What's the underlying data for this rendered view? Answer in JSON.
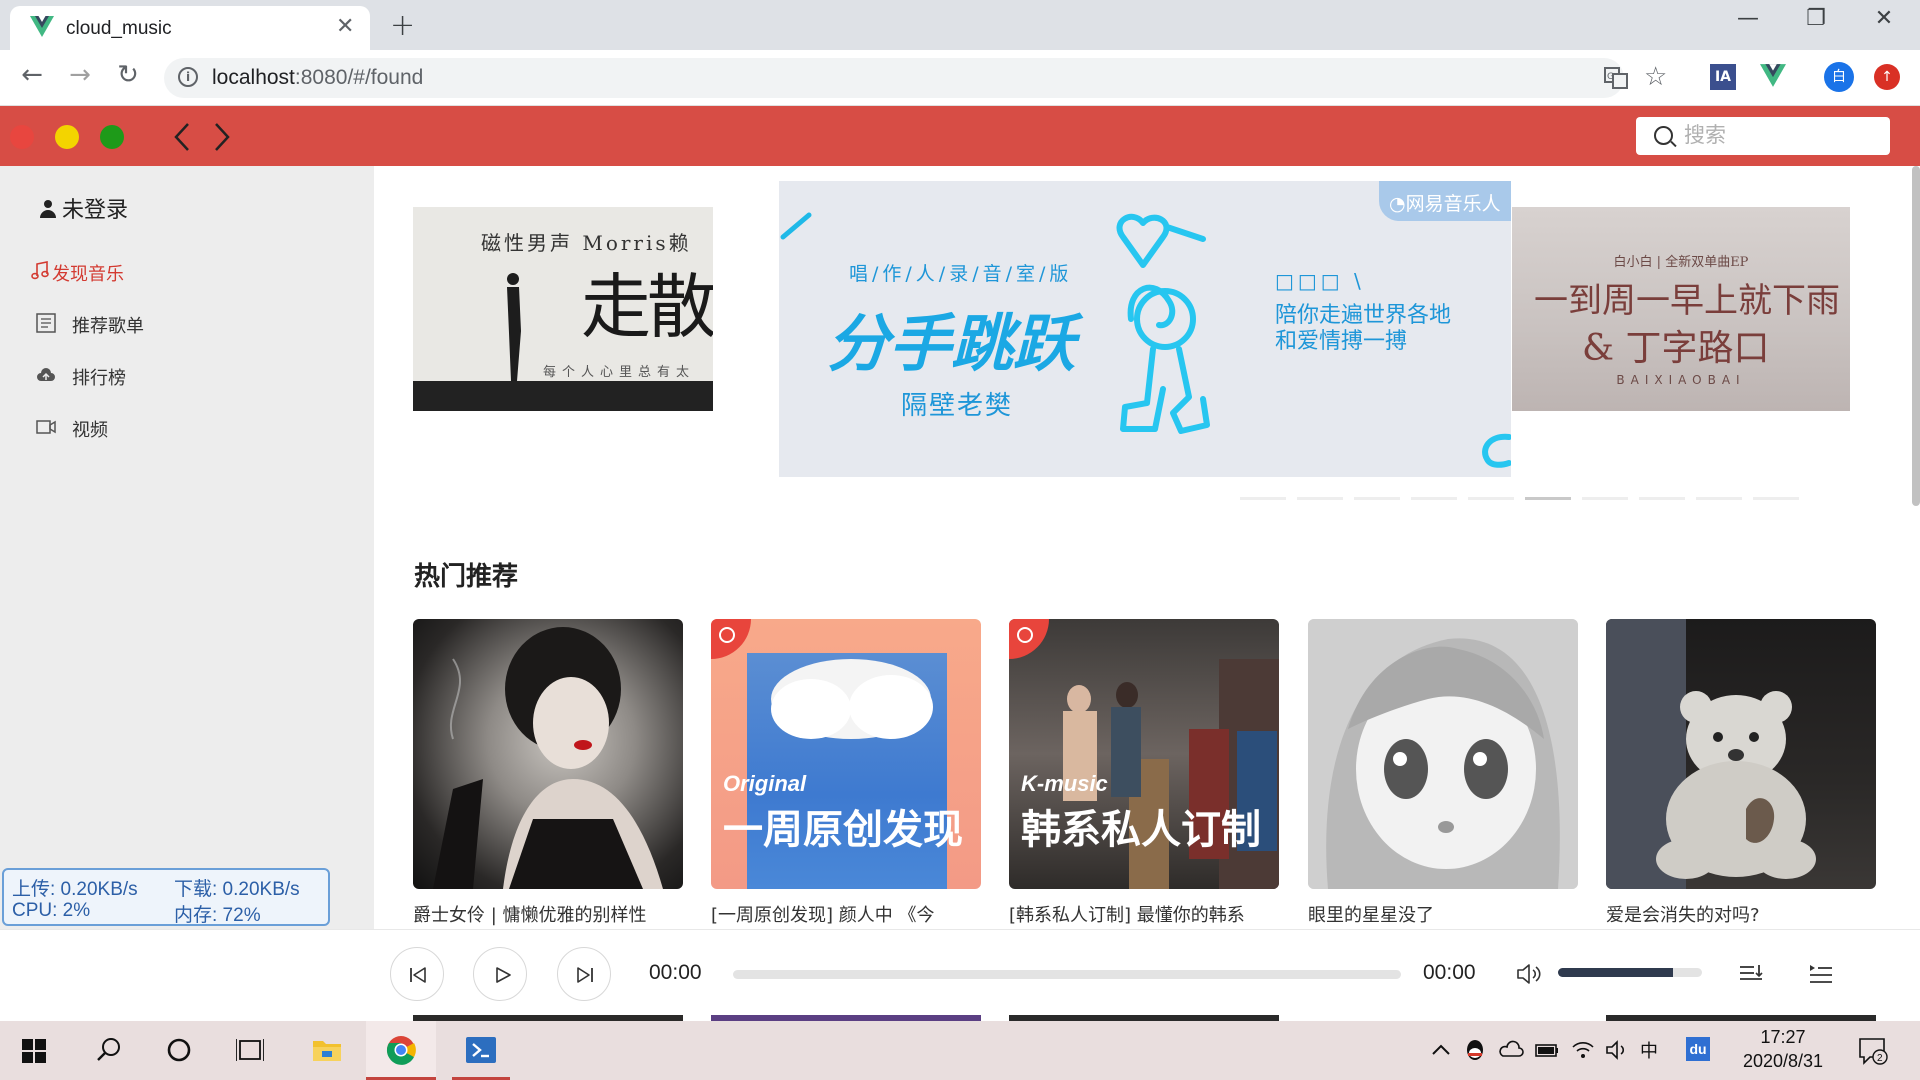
{
  "browser": {
    "tab_title": "cloud_music",
    "tab_close": "✕",
    "new_tab": "+",
    "url_host": "localhost",
    "url_path": ":8080/#/found",
    "window_controls": {
      "minimize": "—",
      "restore": "❐",
      "close": "✕"
    },
    "extensions": [
      "translate-icon",
      "star-icon",
      "ia-icon",
      "vue-devtools-icon",
      "profile-icon",
      "update-icon"
    ],
    "ext_ia_label": "IA",
    "ext_profile_label": "白"
  },
  "app": {
    "accent_color": "#d74d45",
    "traffic_lights": [
      "#e8463f",
      "#f3d400",
      "#1e9a19"
    ],
    "nav_back": "‹",
    "nav_forward": "›",
    "search_placeholder": "搜索"
  },
  "sidebar": {
    "login_label": "未登录",
    "items": [
      {
        "label": "发现音乐",
        "icon": "music-note-icon",
        "active": true
      },
      {
        "label": "推荐歌单",
        "icon": "playlist-icon",
        "active": false
      },
      {
        "label": "排行榜",
        "icon": "cloud-upload-icon",
        "active": false
      },
      {
        "label": "视频",
        "icon": "video-icon",
        "active": false
      }
    ]
  },
  "banners": {
    "left": {
      "line1": "磁性男声  Morris赖",
      "title": "走散",
      "sub": "每个人心里总有太"
    },
    "center": {
      "badge": "网易音乐人",
      "kicker": "唱/作/人/录/音/室/版",
      "title": "分手跳跃",
      "artist": "隔壁老樊",
      "right_top": "□□□ \\",
      "right_line1": "陪你走遍世界各地",
      "right_line2": "和爱情搏一搏"
    },
    "right": {
      "kicker": "白小白 | 全新双单曲EP",
      "line1": "一到周一早上就下雨",
      "line2": "& 丁字路口",
      "sub": "BAIXIAOBAI"
    },
    "indicator_count": 10,
    "indicator_active": 5
  },
  "hot": {
    "title": "热门推荐",
    "cards": [
      {
        "caption": "爵士女伶 | 慵懒优雅的别样性",
        "overlay_small": "",
        "overlay_big": ""
      },
      {
        "caption": "[一周原创发现] 颜人中 《今",
        "overlay_small": "Original",
        "overlay_big": "一周原创发现"
      },
      {
        "caption": "[韩系私人订制] 最懂你的韩系",
        "overlay_small": "K-music",
        "overlay_big": "韩系私人订制"
      },
      {
        "caption": "眼里的星星没了",
        "overlay_small": "",
        "overlay_big": ""
      },
      {
        "caption": "爱是会消失的对吗?",
        "overlay_small": "",
        "overlay_big": ""
      }
    ]
  },
  "netmon": {
    "upload": "上传: 0.20KB/s",
    "download": "下载: 0.20KB/s",
    "cpu": "CPU: 2%",
    "memory": "内存: 72%"
  },
  "player": {
    "current_time": "00:00",
    "total_time": "00:00",
    "progress": 0,
    "volume": 0.8
  },
  "taskbar": {
    "time": "17:27",
    "date": "2020/8/31",
    "ime": "中",
    "notifications": "2",
    "baidu_label": "du"
  }
}
